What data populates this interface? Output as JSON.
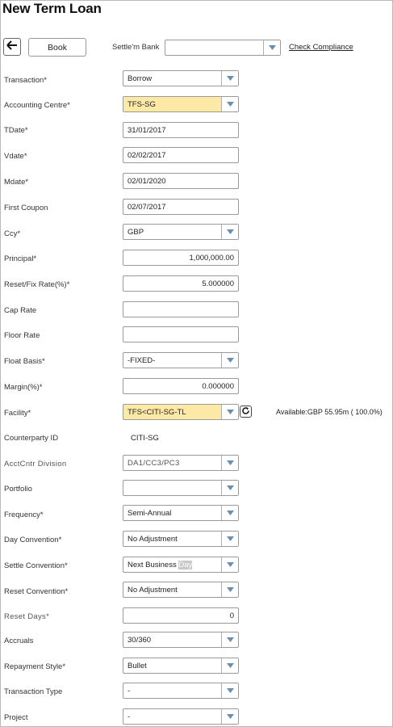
{
  "header": {
    "title": "New Term Loan"
  },
  "toolbar": {
    "back_icon": "arrow-left-icon",
    "book_label": "Book",
    "settle_bank_label": "Settle'm Bank",
    "settle_bank_value": "",
    "check_compliance_label": "Check Compliance"
  },
  "form": {
    "transaction": {
      "label": "Transaction*",
      "value": "Borrow"
    },
    "accounting_centre": {
      "label": "Accounting Centre*",
      "value": "TFS-SG"
    },
    "tdate": {
      "label": "TDate*",
      "value": "31/01/2017"
    },
    "vdate": {
      "label": "Vdate*",
      "value": "02/02/2017"
    },
    "mdate": {
      "label": "Mdate*",
      "value": "02/01/2020"
    },
    "first_coupon": {
      "label": "First Coupon",
      "value": "02/07/2017"
    },
    "ccy": {
      "label": "Ccy*",
      "value": "GBP"
    },
    "principal": {
      "label": "Principal*",
      "value": "1,000,000.00"
    },
    "reset_fix_rate": {
      "label": "Reset/Fix Rate(%)*",
      "value": "5.000000"
    },
    "cap_rate": {
      "label": "Cap Rate",
      "value": ""
    },
    "floor_rate": {
      "label": "Floor Rate",
      "value": ""
    },
    "float_basis": {
      "label": "Float Basis*",
      "value": "-FIXED-"
    },
    "margin": {
      "label": "Margin(%)*",
      "value": "0.000000"
    },
    "facility": {
      "label": "Facility*",
      "value": "TFS<CITI-SG-TL",
      "available": "Available:GBP 55.95m ( 100.0%)"
    },
    "counterparty_id": {
      "label": "Counterparty ID",
      "value": "CITI-SG"
    },
    "acct_cntr_division": {
      "label": "AcctCntr Division",
      "value": "DA1/CC3/PC3"
    },
    "portfolio": {
      "label": "Portfolio",
      "value": ""
    },
    "frequency": {
      "label": "Frequency*",
      "value": "Semi-Annual"
    },
    "day_convention": {
      "label": "Day Convention*",
      "value": "No Adjustment"
    },
    "settle_convention": {
      "label": "Settle Convention*",
      "value": "Next Business ",
      "value_highlight": "Day"
    },
    "reset_convention": {
      "label": "Reset Convention*",
      "value": "No Adjustment"
    },
    "reset_days": {
      "label": "Reset Days*",
      "value": "0"
    },
    "accruals": {
      "label": "Accruals",
      "value": "30/360"
    },
    "repayment_style": {
      "label": "Repayment Style*",
      "value": "Bullet"
    },
    "transaction_type": {
      "label": "Transaction Type",
      "value": "-"
    },
    "project": {
      "label": "Project",
      "value": "-"
    }
  },
  "colors": {
    "required_highlight": "#fde9a6",
    "arrow": "#6a8fb0"
  }
}
